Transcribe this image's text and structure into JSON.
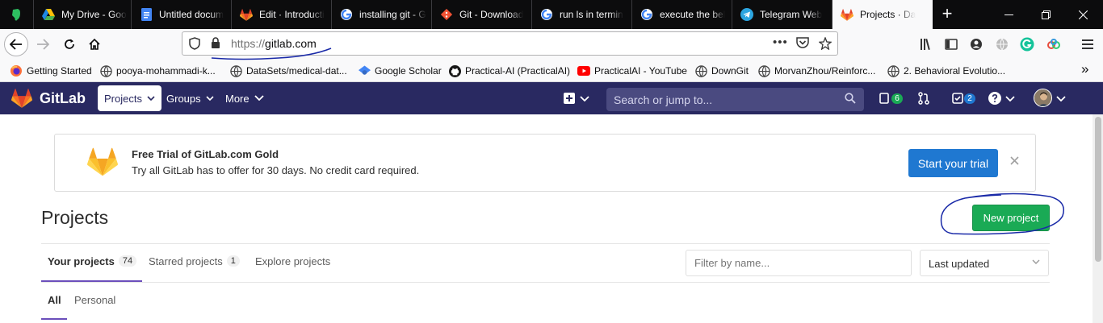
{
  "browser": {
    "tabs": [
      {
        "label": "",
        "icon": "evernote-icon"
      },
      {
        "label": "My Drive - Goo",
        "icon": "google-drive-icon"
      },
      {
        "label": "Untitled docum",
        "icon": "google-docs-icon"
      },
      {
        "label": "Edit · Introducti",
        "icon": "gitlab-icon"
      },
      {
        "label": "installing git - G",
        "icon": "google-icon"
      },
      {
        "label": "Git - Download",
        "icon": "git-icon"
      },
      {
        "label": "run ls in termin",
        "icon": "google-icon"
      },
      {
        "label": "execute the bel",
        "icon": "google-icon"
      },
      {
        "label": "Telegram Web",
        "icon": "telegram-icon"
      },
      {
        "label": "Projects · Da",
        "icon": "gitlab-icon"
      }
    ],
    "new_tab_label": "+",
    "url_protocol": "https://",
    "url_host": "gitlab.com",
    "url_more": "•••",
    "bookmarks": [
      {
        "label": "Getting Started",
        "icon": "firefox-icon"
      },
      {
        "label": "pooya-mohammadi-k...",
        "icon": "globe-icon"
      },
      {
        "label": "DataSets/medical-dat...",
        "icon": "globe-icon"
      },
      {
        "label": "Google Scholar",
        "icon": "scholar-icon"
      },
      {
        "label": "Practical-AI (PracticalAI)",
        "icon": "github-icon"
      },
      {
        "label": "PracticalAI - YouTube",
        "icon": "youtube-icon"
      },
      {
        "label": "DownGit",
        "icon": "globe-icon"
      },
      {
        "label": "MorvanZhou/Reinforc...",
        "icon": "globe-icon"
      },
      {
        "label": "2. Behavioral Evolutio...",
        "icon": "globe-icon"
      }
    ],
    "bookmarks_overflow": "»"
  },
  "gitlab": {
    "brand": "GitLab",
    "nav": {
      "projects": "Projects",
      "groups": "Groups",
      "more": "More"
    },
    "search_placeholder": "Search or jump to...",
    "issues_count": "6",
    "todos_count": "2",
    "trial_banner": {
      "title": "Free Trial of GitLab.com Gold",
      "subtitle": "Try all GitLab has to offer for 30 days. No credit card required.",
      "button": "Start your trial"
    },
    "page_title": "Projects",
    "new_project_button": "New project",
    "tabs": [
      {
        "label": "Your projects",
        "count": "74"
      },
      {
        "label": "Starred projects",
        "count": "1"
      },
      {
        "label": "Explore projects",
        "count": ""
      }
    ],
    "filter_placeholder": "Filter by name...",
    "sort_value": "Last updated",
    "subtabs": [
      "All",
      "Personal"
    ]
  },
  "colors": {
    "header_bg": "#292961",
    "accent_purple": "#6b4fbb",
    "trial_blue": "#1f78d1",
    "success_green": "#1aaa55",
    "annotation_ink": "#1a2aa8"
  }
}
